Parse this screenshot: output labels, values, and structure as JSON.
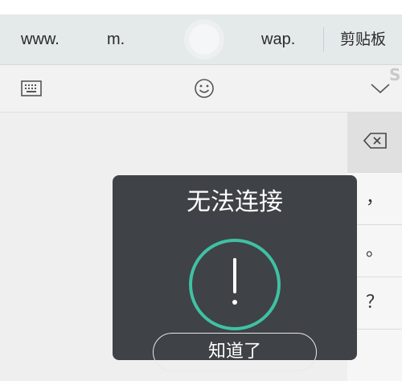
{
  "suggestions": {
    "items": [
      "www.",
      "m.",
      "wap."
    ],
    "clipboard_label": "剪贴板"
  },
  "side_keys": {
    "comma": "，",
    "period": "。",
    "question": "？"
  },
  "dialog": {
    "title": "无法连接",
    "button_label": "知道了",
    "accent_color": "#3fc1a4",
    "background_color": "#3f4246"
  },
  "icons": {
    "keyboard": "keyboard-icon",
    "emoji": "smiley-icon",
    "collapse": "chevron-down-icon",
    "backspace": "backspace-icon",
    "alert": "exclamation-icon"
  }
}
